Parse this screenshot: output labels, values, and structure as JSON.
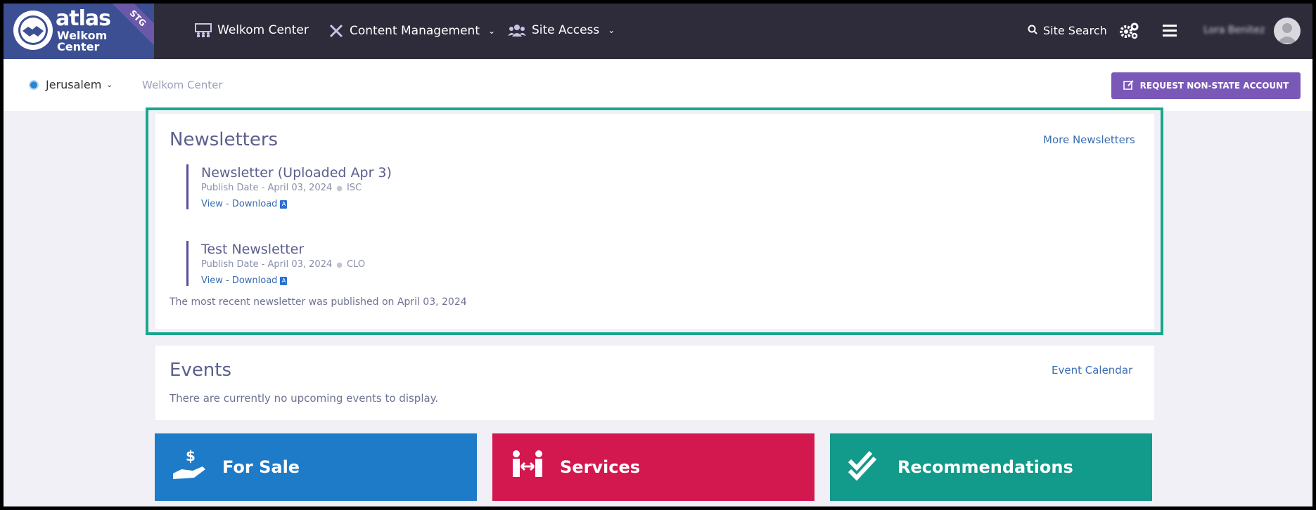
{
  "logo": {
    "brand": "atlas",
    "subtitle_line1": "Welkom",
    "subtitle_line2": "Center",
    "env_badge": "STG"
  },
  "nav": {
    "items": [
      {
        "label": "Welkom Center",
        "icon": "people-board-icon"
      },
      {
        "label": "Content Management",
        "icon": "tools-icon"
      },
      {
        "label": "Site Access",
        "icon": "users-icon"
      }
    ],
    "site_search": "Site Search",
    "user_name": "Lora Benitez"
  },
  "subbar": {
    "location": "Jerusalem",
    "breadcrumb": "Welkom Center",
    "request_button": "REQUEST NON-STATE ACCOUNT"
  },
  "newsletters": {
    "title": "Newsletters",
    "more_link": "More Newsletters",
    "items": [
      {
        "title": "Newsletter (Uploaded Apr 3)",
        "publish": "Publish Date - April 03, 2024",
        "source": "ISC",
        "actions": "View - Download"
      },
      {
        "title": "Test Newsletter",
        "publish": "Publish Date - April 03, 2024",
        "source": "CLO",
        "actions": "View - Download"
      }
    ],
    "note": "The most recent newsletter was published on April 03, 2024"
  },
  "events": {
    "title": "Events",
    "calendar_link": "Event Calendar",
    "empty": "There are currently no upcoming events to display."
  },
  "tiles": [
    {
      "label": "For Sale",
      "color": "#1e7bc8",
      "icon": "hand-dollar-icon"
    },
    {
      "label": "Services",
      "color": "#d3174f",
      "icon": "people-exchange-icon"
    },
    {
      "label": "Recommendations",
      "color": "#129a8a",
      "icon": "double-check-icon"
    }
  ]
}
